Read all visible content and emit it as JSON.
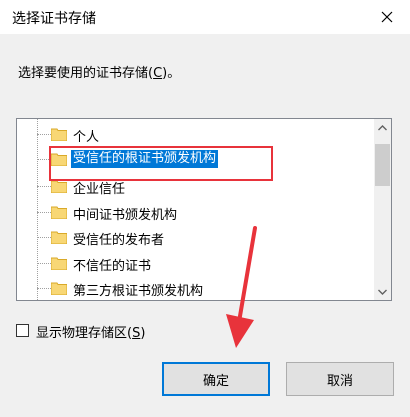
{
  "window": {
    "title": "选择证书存储"
  },
  "prompt": {
    "text": "选择要使用的证书存储(",
    "accel": "C",
    "suffix": ")。"
  },
  "tree": {
    "items": [
      {
        "label": "个人"
      },
      {
        "label": "受信任的根证书颁发机构",
        "selected": true
      },
      {
        "label": "企业信任"
      },
      {
        "label": "中间证书颁发机构"
      },
      {
        "label": "受信任的发布者"
      },
      {
        "label": "不信任的证书"
      },
      {
        "label": "第三方根证书颁发机构"
      }
    ]
  },
  "checkbox": {
    "text": "显示物理存储区(",
    "accel": "S",
    "suffix": ")",
    "checked": false
  },
  "buttons": {
    "ok": "确定",
    "cancel": "取消"
  },
  "colors": {
    "selection": "#0078d7",
    "annotation": "#e8333b",
    "folder": "#f8d775"
  },
  "icons": {
    "close": "close-icon",
    "folder": "folder-icon",
    "scroll_up": "chevron-up-icon",
    "scroll_down": "chevron-down-icon"
  }
}
